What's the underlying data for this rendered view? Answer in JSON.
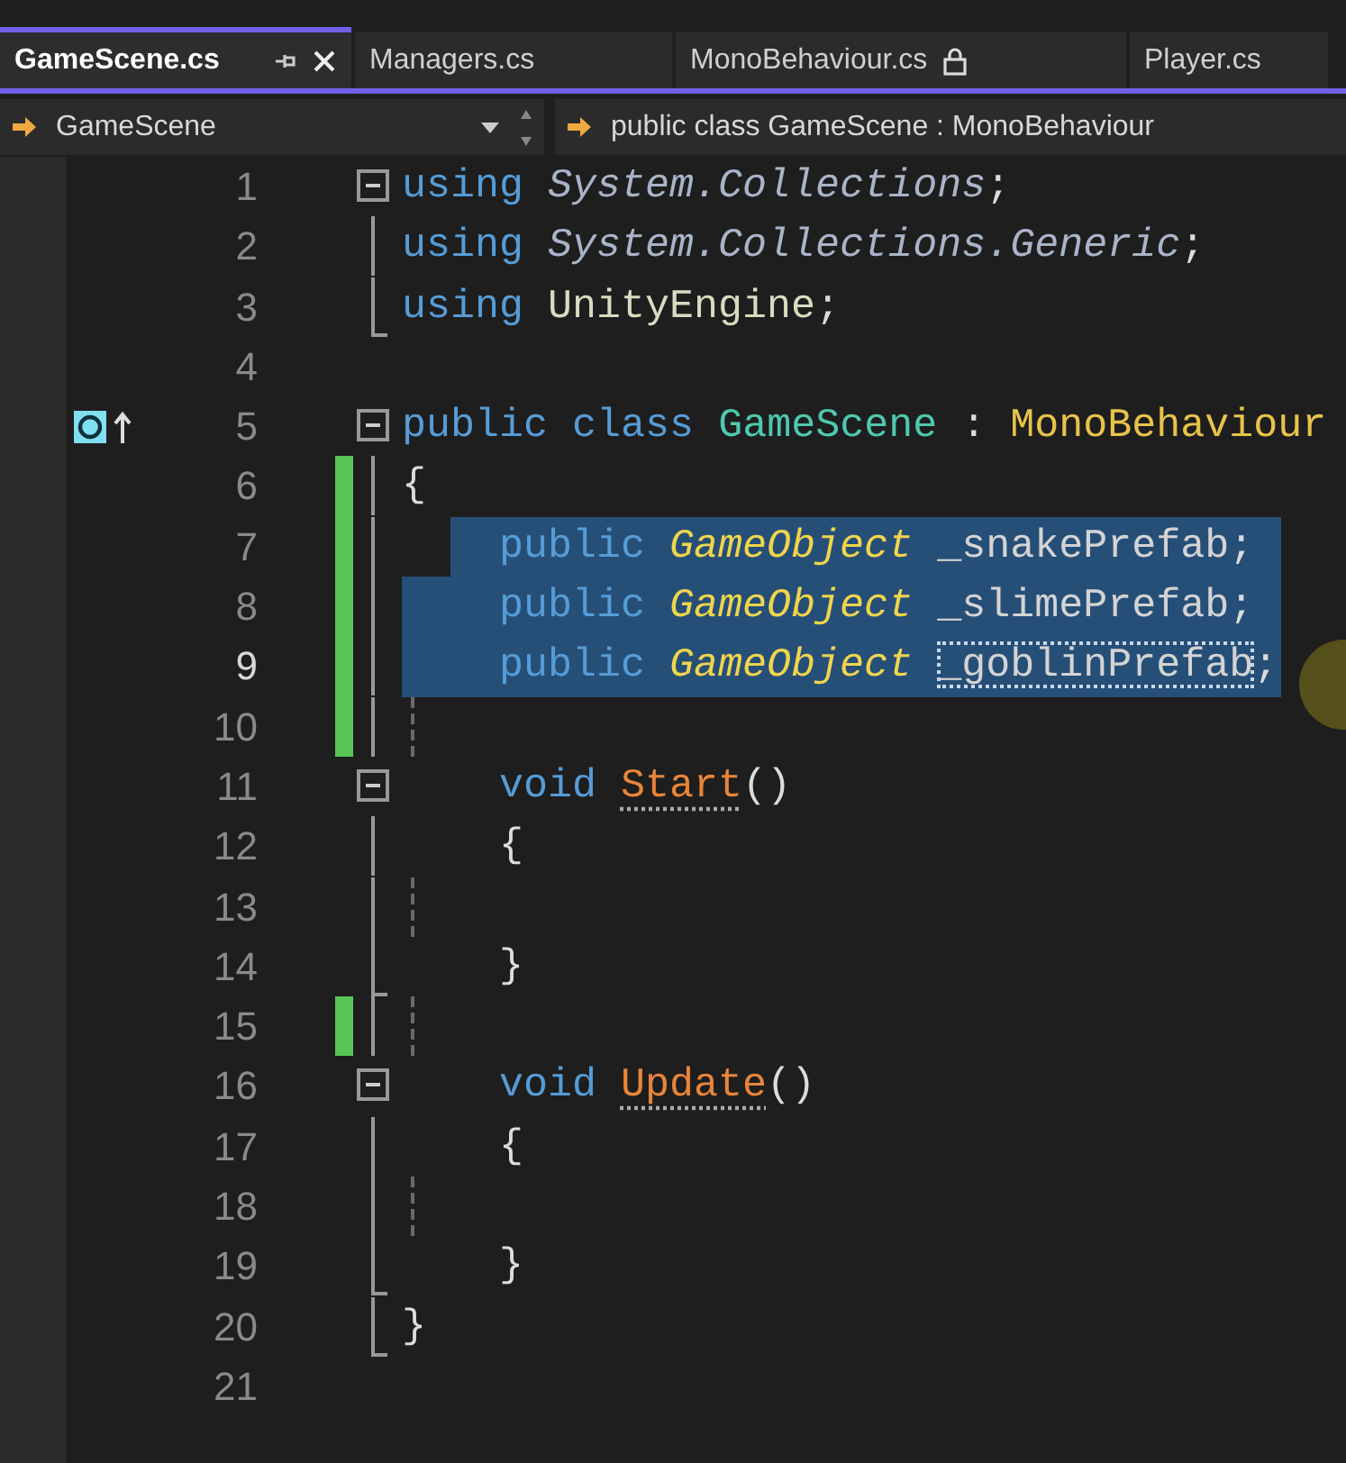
{
  "tabs": [
    {
      "label": "GameScene.cs",
      "selected": true,
      "read_only": false
    },
    {
      "label": "Managers.cs",
      "selected": false,
      "read_only": false
    },
    {
      "label": "MonoBehaviour.cs",
      "selected": false,
      "read_only": true
    },
    {
      "label": "Player.cs",
      "selected": false,
      "read_only": false
    }
  ],
  "navigation": {
    "type_dropdown": "GameScene",
    "member_dropdown": "public class GameScene : MonoBehaviour"
  },
  "lines": [
    {
      "number": "1",
      "kind": "start",
      "tokens": [
        {
          "text": "using",
          "kind": "keyword"
        },
        {
          "text": "System.Collections",
          "kind": "namespace"
        },
        {
          "text": ";",
          "kind": "punct"
        }
      ]
    },
    {
      "number": "2",
      "kind": "inner",
      "tokens": [
        {
          "text": "using",
          "kind": "keyword"
        },
        {
          "text": "System.Collections.Generic",
          "kind": "namespace"
        },
        {
          "text": ";",
          "kind": "punct"
        }
      ]
    },
    {
      "number": "3",
      "kind": "end",
      "tokens": [
        {
          "text": "using",
          "kind": "keyword"
        },
        {
          "text": "UnityEngine",
          "kind": "namespace_used"
        },
        {
          "text": ";",
          "kind": "punct"
        }
      ]
    },
    {
      "number": "4"
    },
    {
      "number": "5",
      "kind": "start",
      "margin_icon": true,
      "tokens": [
        {
          "text": "public",
          "kind": "keyword"
        },
        {
          "text": "class",
          "kind": "keyword"
        },
        {
          "text": "GameScene",
          "kind": "class"
        },
        {
          "text": ":",
          "kind": "operator"
        },
        {
          "text": "MonoBehaviour",
          "kind": "base"
        }
      ]
    },
    {
      "number": "6",
      "kind": "inner",
      "changed": true,
      "tokens": [
        {
          "text": "{",
          "kind": "punct"
        }
      ]
    },
    {
      "number": "7",
      "kind": "inner",
      "changed": true,
      "indented": true,
      "selected": true,
      "tokens": [
        {
          "text": "public",
          "kind": "keyword"
        },
        {
          "text": "GameObject",
          "kind": "type"
        },
        {
          "text": "_snakePrefab",
          "kind": "field"
        },
        {
          "text": ";",
          "kind": "punct"
        }
      ]
    },
    {
      "number": "8",
      "kind": "inner",
      "changed": true,
      "indented": true,
      "selected": true,
      "tokens": [
        {
          "text": "public",
          "kind": "keyword"
        },
        {
          "text": "GameObject",
          "kind": "type"
        },
        {
          "text": "_slimePrefab",
          "kind": "field"
        },
        {
          "text": ";",
          "kind": "punct"
        }
      ]
    },
    {
      "number": "9",
      "kind": "inner",
      "changed": true,
      "indented": true,
      "selected": true,
      "cursor": true,
      "tokens": [
        {
          "text": "public",
          "kind": "keyword"
        },
        {
          "text": "GameObject",
          "kind": "type"
        },
        {
          "text": "_goblinPrefab",
          "kind": "field",
          "highlighted": true
        },
        {
          "text": ";",
          "kind": "punct"
        }
      ]
    },
    {
      "number": "10",
      "kind": "inner",
      "changed": true
    },
    {
      "number": "11",
      "kind": "start",
      "indented": true,
      "tokens": [
        {
          "text": "void",
          "kind": "keyword"
        },
        {
          "text": "Start",
          "kind": "method"
        },
        {
          "text": "()",
          "kind": "punct"
        }
      ]
    },
    {
      "number": "12",
      "kind": "inner",
      "indented": true,
      "tokens": [
        {
          "text": "{",
          "kind": "punct"
        }
      ]
    },
    {
      "number": "13",
      "kind": "inner"
    },
    {
      "number": "14",
      "kind": "end",
      "indented": true,
      "tokens": [
        {
          "text": "}",
          "kind": "punct"
        }
      ]
    },
    {
      "number": "15",
      "kind": "inner",
      "changed": true
    },
    {
      "number": "16",
      "kind": "start",
      "indented": true,
      "tokens": [
        {
          "text": "void",
          "kind": "keyword"
        },
        {
          "text": "Update",
          "kind": "method"
        },
        {
          "text": "()",
          "kind": "punct"
        }
      ]
    },
    {
      "number": "17",
      "kind": "inner",
      "indented": true,
      "tokens": [
        {
          "text": "{",
          "kind": "punct"
        }
      ]
    },
    {
      "number": "18",
      "kind": "inner"
    },
    {
      "number": "19",
      "kind": "end",
      "indented": true,
      "tokens": [
        {
          "text": "}",
          "kind": "punct"
        }
      ]
    },
    {
      "number": "20",
      "kind": "end",
      "tokens": [
        {
          "text": "}",
          "kind": "punct"
        }
      ]
    },
    {
      "number": "21"
    }
  ]
}
